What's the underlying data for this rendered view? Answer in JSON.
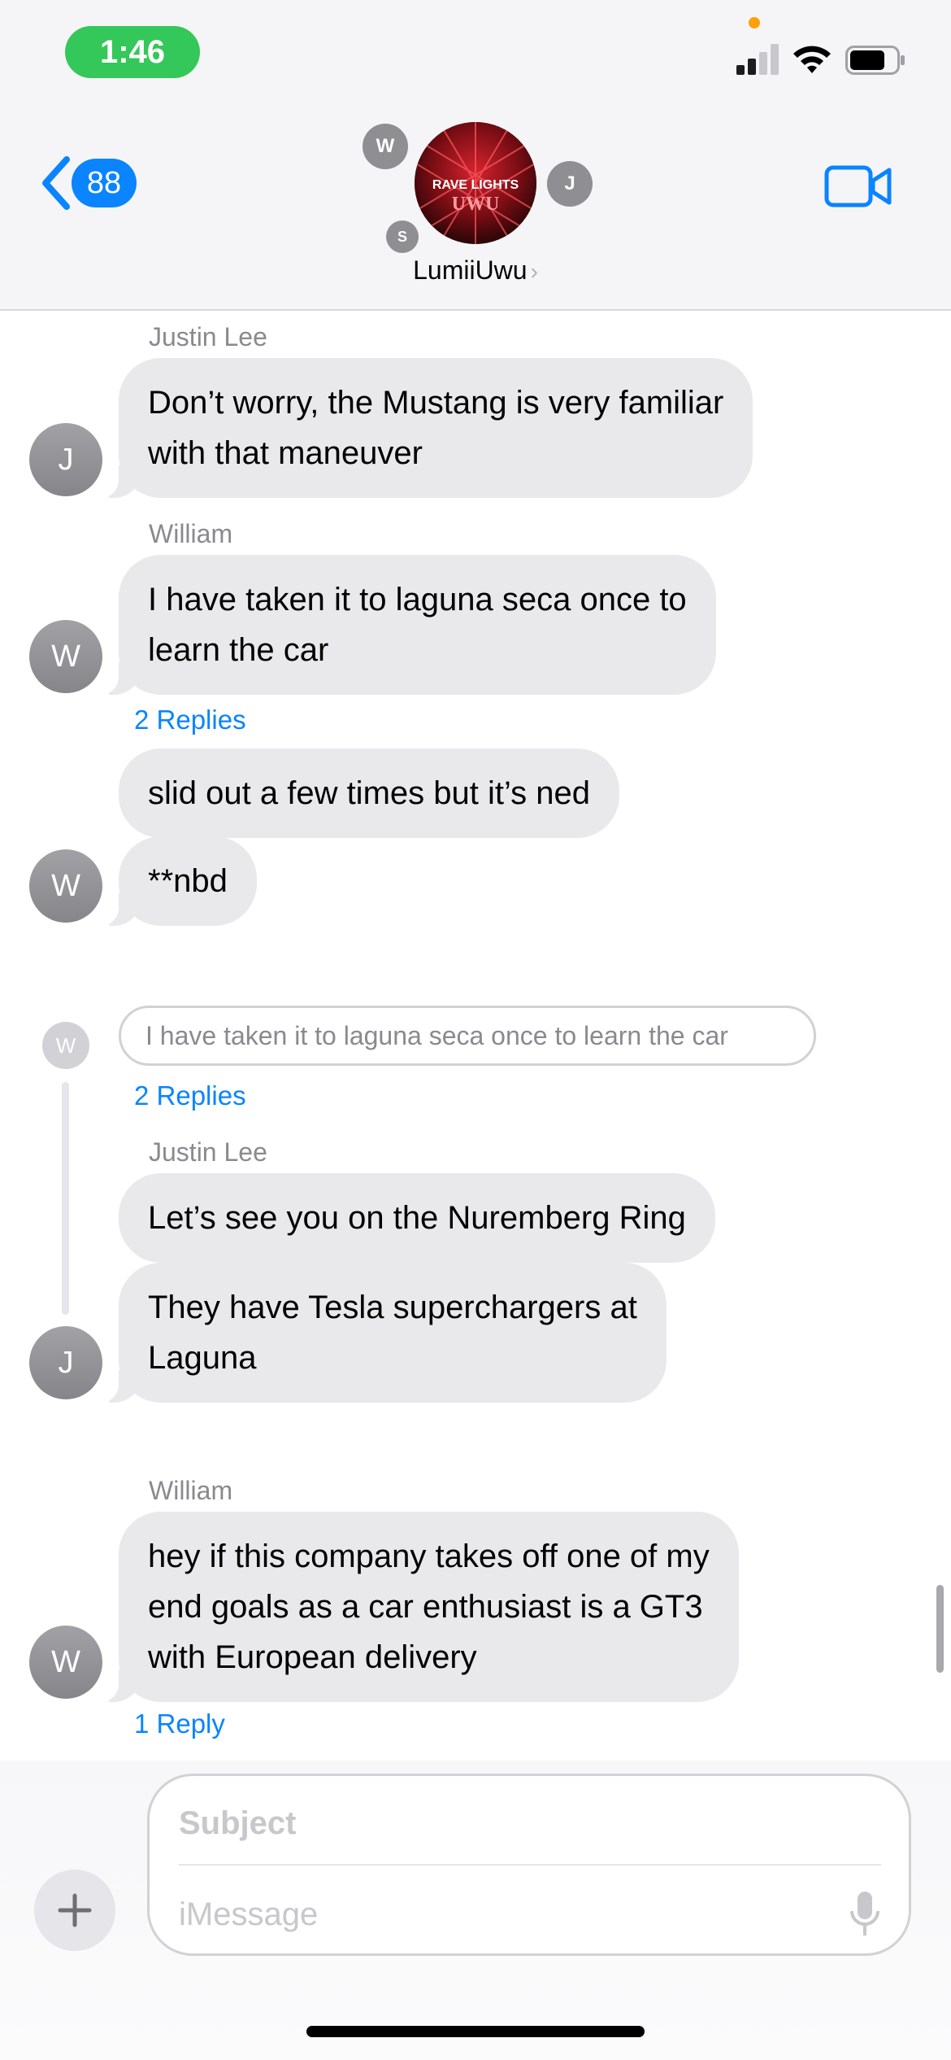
{
  "status_bar": {
    "time": "1:46",
    "icons": [
      "cellular-signal-icon",
      "wifi-icon",
      "battery-icon"
    ],
    "recording_dot_color": "#ff9f0a"
  },
  "header": {
    "back_count": "88",
    "group_name": "LumiiUwu",
    "group_avatar_text_top": "RAVE LIGHTS",
    "group_avatar_text_bottom": "UWU",
    "member_initials": {
      "w": "W",
      "j": "J",
      "s": "S"
    },
    "video_icon": "video-camera-icon"
  },
  "messages": [
    {
      "sender": "Justin Lee",
      "initial": "J",
      "text_line1": "Don’t worry, the Mustang is very familiar",
      "text_line2": "with that maneuver"
    },
    {
      "sender": "William",
      "initial": "W",
      "text_line1": "I have taken it to laguna seca once to",
      "text_line2": "learn the car",
      "replies": "2 Replies"
    },
    {
      "initial": "W",
      "text": "slid out a few times but it’s ned"
    },
    {
      "initial": "W",
      "text": "**nbd"
    }
  ],
  "thread": {
    "quote_initial": "W",
    "quote_text": "I have taken it to laguna seca once to learn the car",
    "replies": "2 Replies",
    "sender": "Justin Lee",
    "initial": "J",
    "msg1": "Let’s see you on the Nuremberg Ring",
    "msg2_line1": "They have Tesla superchargers at",
    "msg2_line2": "Laguna"
  },
  "last_message": {
    "sender": "William",
    "initial": "W",
    "line1": "hey if this company takes off one of my",
    "line2": "end goals as a car enthusiast is a GT3",
    "line3": "with European delivery",
    "replies": "1 Reply"
  },
  "composer": {
    "subject_placeholder": "Subject",
    "message_placeholder": "iMessage"
  },
  "colors": {
    "accent": "#0a84ff",
    "bubble": "#e9e9eb",
    "time_pill": "#34c759"
  }
}
